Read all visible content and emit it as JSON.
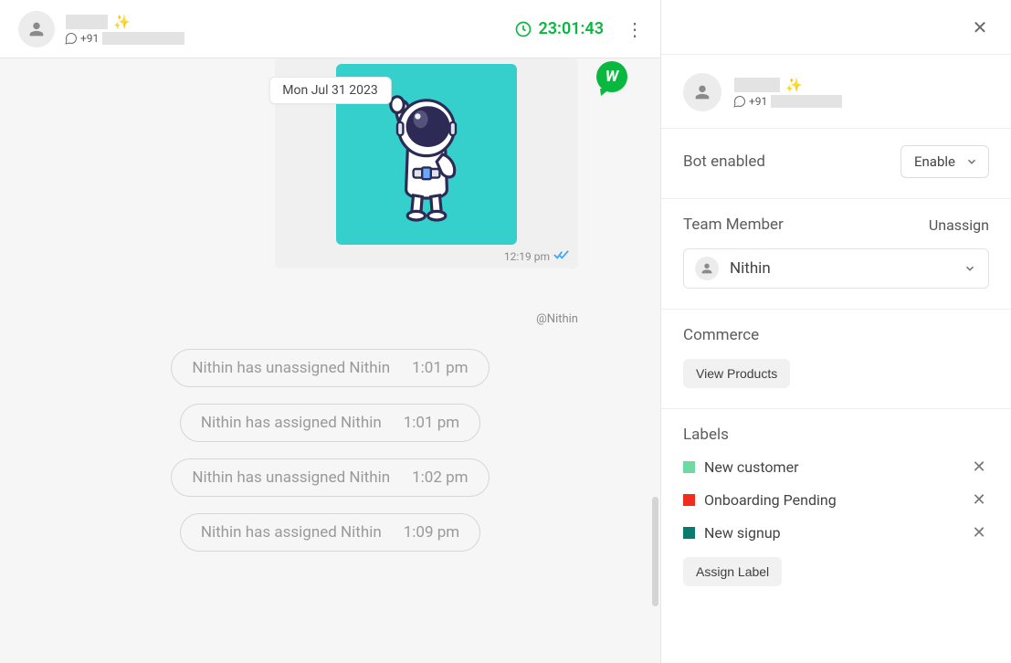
{
  "chat": {
    "date_chip": "Mon Jul 31 2023",
    "timer": "23:01:43",
    "contact": {
      "phone_prefix": "+91"
    },
    "message": {
      "time": "12:19 pm",
      "author_tag": "@Nithin"
    },
    "system_events": [
      {
        "text": "Nithin has unassigned Nithin",
        "time": "1:01 pm"
      },
      {
        "text": "Nithin has assigned Nithin",
        "time": "1:01 pm"
      },
      {
        "text": "Nithin has unassigned Nithin",
        "time": "1:02 pm"
      },
      {
        "text": "Nithin has assigned Nithin",
        "time": "1:09 pm"
      }
    ]
  },
  "side": {
    "contact": {
      "phone_prefix": "+91"
    },
    "bot_section": {
      "label": "Bot enabled",
      "value": "Enable"
    },
    "team_section": {
      "label": "Team Member",
      "unassign_text": "Unassign",
      "assignee": "Nithin"
    },
    "commerce_section": {
      "label": "Commerce",
      "button": "View Products"
    },
    "labels_section": {
      "label": "Labels",
      "items": [
        {
          "color": "#6fd9a3",
          "text": "New customer"
        },
        {
          "color": "#f12c1f",
          "text": "Onboarding Pending"
        },
        {
          "color": "#0b7a6e",
          "text": "New signup"
        }
      ],
      "assign_button": "Assign Label"
    }
  }
}
